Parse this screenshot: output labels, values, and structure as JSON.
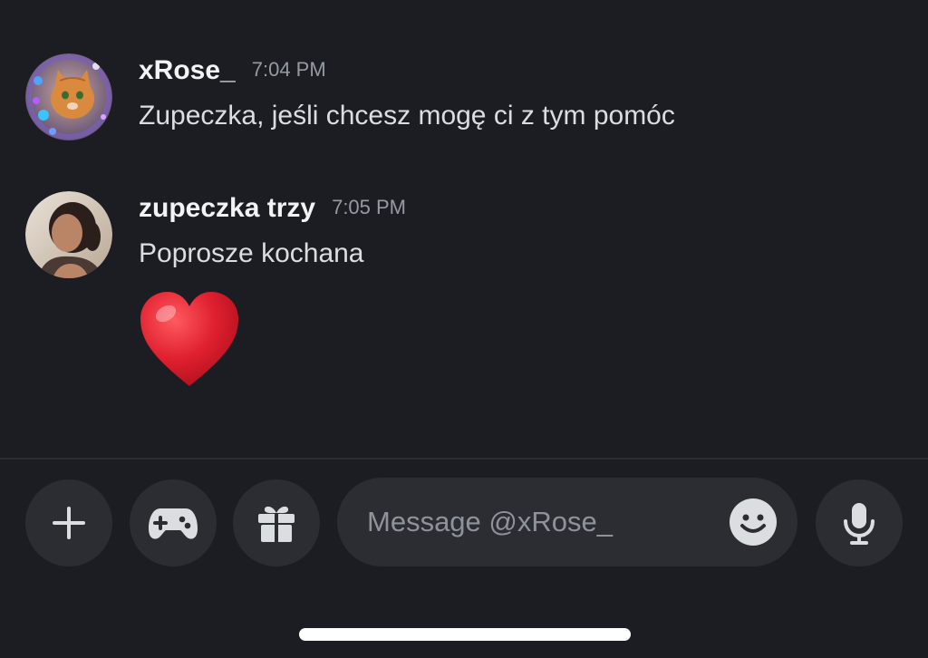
{
  "messages": [
    {
      "username": "xRose_",
      "timestamp": "7:04 PM",
      "text": "Zupeczka, jeśli chcesz mogę ci z tym pomóc"
    },
    {
      "username": "zupeczka trzy",
      "timestamp": "7:05 PM",
      "text": "Poprosze kochana",
      "emoji": "heart"
    }
  ],
  "composer": {
    "placeholder": "Message @xRose_"
  },
  "icons": {
    "add": "plus-icon",
    "activities": "gamepad-icon",
    "gift": "gift-icon",
    "emoji": "smile-icon",
    "voice": "microphone-icon"
  },
  "colors": {
    "background": "#1c1d22",
    "control": "#2b2d33",
    "username": "#f2f3f5",
    "timestamp": "#949ba4",
    "heart": "#e0202f"
  }
}
